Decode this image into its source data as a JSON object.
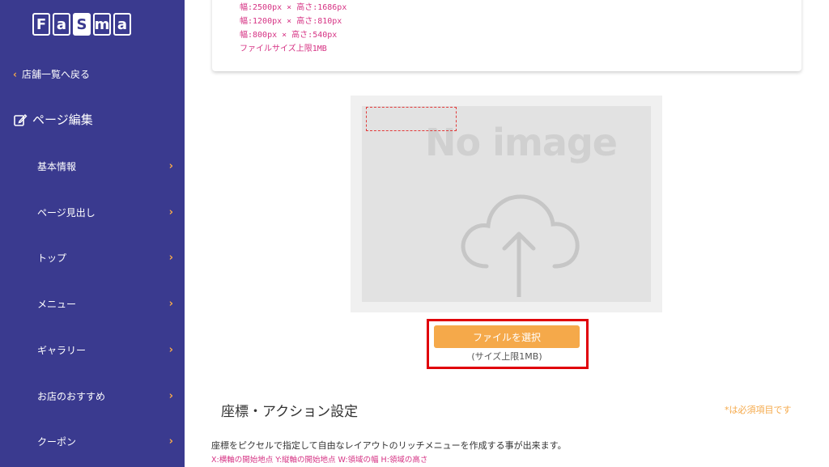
{
  "sidebar": {
    "logo": [
      "F",
      "a",
      "S",
      "m",
      "a"
    ],
    "back_label": "店舗一覧へ戻る",
    "section_title": "ページ編集",
    "items": [
      {
        "label": "基本情報"
      },
      {
        "label": "ページ見出し"
      },
      {
        "label": "トップ"
      },
      {
        "label": "メニュー"
      },
      {
        "label": "ギャラリー"
      },
      {
        "label": "お店のおすすめ"
      },
      {
        "label": "クーポン"
      }
    ]
  },
  "specs": {
    "line1": "幅:2500px × 高さ:1686px",
    "line2": "幅:1200px × 高さ:810px",
    "line3": "幅:800px × 高さ:540px",
    "line4": "ファイルサイズ上限1MB"
  },
  "upload": {
    "placeholder_text": "No image",
    "button_label": "ファイルを選択",
    "size_note": "(サイズ上限1MB)"
  },
  "coords": {
    "title": "座標・アクション設定",
    "required_note": "*は必須項目です",
    "description": "座標をピクセルで指定して自由なレイアウトのリッチメニューを作成する事が出来ます。",
    "axis_note": "X:横軸の開始地点 Y:縦軸の開始地点 W:領域の幅 H:領域の高さ"
  },
  "colors": {
    "sidebar_bg": "#3a3a8f",
    "accent": "#f5a94a",
    "highlight": "#e0000a",
    "spec_text": "#d63384"
  }
}
